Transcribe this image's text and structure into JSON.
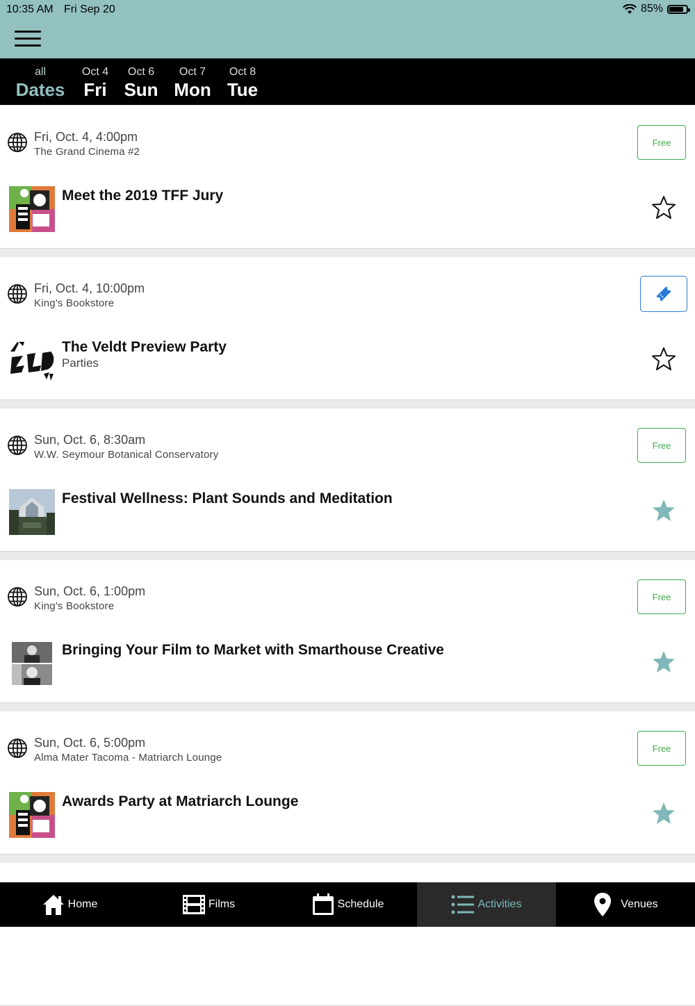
{
  "status_bar": {
    "time": "10:35 AM",
    "date": "Fri Sep 20",
    "battery": "85%",
    "battery_level": 0.85
  },
  "date_tabs": [
    {
      "small": "all",
      "big": "Dates",
      "active": true
    },
    {
      "small": "Oct 4",
      "big": "Fri",
      "active": false
    },
    {
      "small": "Oct 6",
      "big": "Sun",
      "active": false
    },
    {
      "small": "Oct 7",
      "big": "Mon",
      "active": false
    },
    {
      "small": "Oct 8",
      "big": "Tue",
      "active": false
    }
  ],
  "events": [
    {
      "when": "Fri, Oct. 4, 4:00pm",
      "venue": "The Grand Cinema #2",
      "title": "Meet the 2019 TFF Jury",
      "category": "",
      "action": "Free",
      "action_type": "price",
      "starred": false,
      "thumb": "tff-poster"
    },
    {
      "when": "Fri, Oct. 4, 10:00pm",
      "venue": "King's Bookstore",
      "title": "The Veldt Preview Party",
      "category": "Parties",
      "action": "",
      "action_type": "ticket",
      "starred": false,
      "thumb": "veldt-logo"
    },
    {
      "when": "Sun, Oct. 6, 8:30am",
      "venue": "W.W. Seymour Botanical Conservatory",
      "title": "Festival Wellness: Plant Sounds and Meditation",
      "category": "",
      "action": "Free",
      "action_type": "price",
      "starred": true,
      "thumb": "conservatory-photo"
    },
    {
      "when": "Sun, Oct. 6, 1:00pm",
      "venue": "King's Bookstore",
      "title": "Bringing Your Film to Market with Smarthouse Creative",
      "category": "",
      "action": "Free",
      "action_type": "price",
      "starred": true,
      "thumb": "portraits-photo"
    },
    {
      "when": "Sun, Oct. 6, 5:00pm",
      "venue": "Alma Mater Tacoma - Matriarch Lounge",
      "title": "Awards Party at Matriarch Lounge",
      "category": "",
      "action": "Free",
      "action_type": "price",
      "starred": true,
      "thumb": "tff-poster"
    }
  ],
  "tab_bar": [
    {
      "label": "Home",
      "icon": "home-icon",
      "active": false
    },
    {
      "label": "Films",
      "icon": "film-icon",
      "active": false
    },
    {
      "label": "Schedule",
      "icon": "calendar-icon",
      "active": false
    },
    {
      "label": "Activities",
      "icon": "list-icon",
      "active": true
    },
    {
      "label": "Venues",
      "icon": "map-pin-icon",
      "active": false
    }
  ],
  "colors": {
    "header_bg": "#92c1c0",
    "accent": "#92c1c0",
    "free_green": "#3eac4a",
    "ticket_blue": "#2a7bd8",
    "star_filled": "#7fb8b7"
  }
}
